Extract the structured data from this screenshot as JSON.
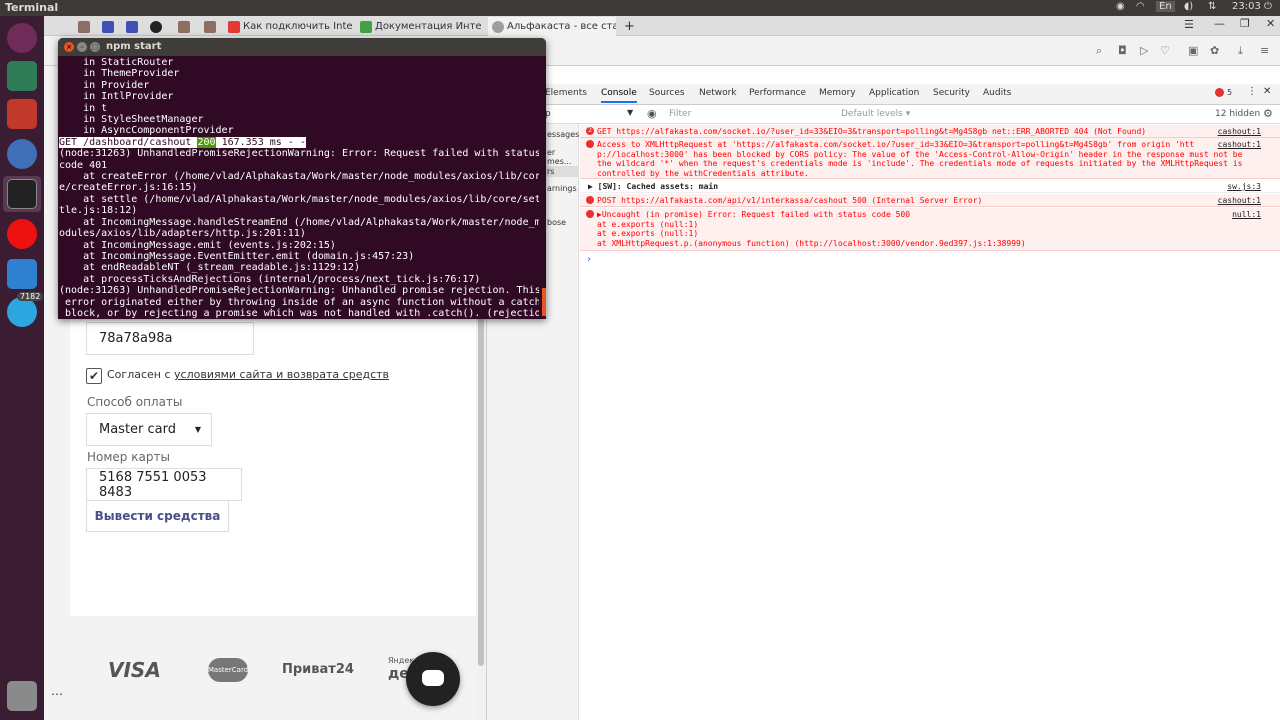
{
  "os": {
    "app_title": "Terminal",
    "lang": "En",
    "clock": "23:03",
    "telegram_badge": "7182",
    "terminal_title": "npm start"
  },
  "browser": {
    "tabs": [
      {
        "label": "",
        "color": "#8d6e63"
      },
      {
        "label": "",
        "color": "#3f51b5"
      },
      {
        "label": "",
        "color": "#3f51b5"
      },
      {
        "label": "",
        "color": "#222222"
      },
      {
        "label": "",
        "color": "#8d6e63"
      },
      {
        "label": "",
        "color": "#8d6e63"
      },
      {
        "label": "Как подключить Inte",
        "color": "#e53935"
      },
      {
        "label": "Документация Инте",
        "color": "#43a047"
      },
      {
        "label": "Альфакаста - все ста",
        "color": "#9e9e9e"
      }
    ]
  },
  "devtools": {
    "tabs": [
      "Elements",
      "Console",
      "Sources",
      "Network",
      "Performance",
      "Memory",
      "Application",
      "Security",
      "Audits"
    ],
    "active_tab": "Console",
    "error_count": "5",
    "context": "p",
    "filter_placeholder": "Filter",
    "levels": "Default levels ▾",
    "hidden": "12 hidden",
    "sidebar": [
      "essages",
      "er mes...",
      "rs",
      "arnings",
      "bose"
    ],
    "console": [
      {
        "type": "error",
        "badge": "2",
        "text": "GET https://alfakasta.com/socket.io/?user_id=33&EIO=3&transport=polling&t=Mg4S8gb net::ERR_ABORTED 404 (Not Found)",
        "source": "cashout:1"
      },
      {
        "type": "error",
        "lines": [
          "Access to XMLHttpRequest at 'https://alfakasta.com/socket.io/?user_id=33&EIO=3&transport=polling&t=Mg4S8gb' from origin 'htt",
          "p://localhost:3000' has been blocked by CORS policy: The value of the 'Access-Control-Allow-Origin' header in the response must not be",
          "the wildcard '*' when the request's credentials mode is 'include'. The credentials mode of requests initiated by the XMLHttpRequest is",
          "controlled by the withCredentials attribute."
        ],
        "source": "cashout:1"
      },
      {
        "type": "info",
        "text": "▶ [SW]: Cached assets: main",
        "source": "sw.js:3"
      },
      {
        "type": "error",
        "text": "POST https://alfakasta.com/api/v1/interkassa/cashout 500 (Internal Server Error)",
        "source": "cashout:1"
      },
      {
        "type": "error",
        "lines": [
          "▶Uncaught (in promise) Error: Request failed with status code 500",
          "    at e.exports (null:1)",
          "    at e.exports (null:1)",
          "    at XMLHttpRequest.p.(anonymous function) (http://localhost:3000/vendor.9ed397.js:1:38999)"
        ],
        "source": "null:1"
      }
    ],
    "prompt": "›"
  },
  "terminal": {
    "lines_before": [
      "    in StaticRouter",
      "    in ThemeProvider",
      "    in Provider",
      "    in IntlProvider",
      "    in t",
      "    in StyleSheetManager",
      "    in AsyncComponentProvider"
    ],
    "request": {
      "method_path": "GET /dashboard/cashout ",
      "status": "200",
      "rest": " 167.353 ms - -"
    },
    "lines_after": [
      "(node:31263) UnhandledPromiseRejectionWarning: Error: Request failed with status",
      "code 401",
      "    at createError (/home/vlad/Alphakasta/Work/master/node_modules/axios/lib/cor",
      "e/createError.js:16:15)",
      "    at settle (/home/vlad/Alphakasta/Work/master/node_modules/axios/lib/core/set",
      "tle.js:18:12)",
      "    at IncomingMessage.handleStreamEnd (/home/vlad/Alphakasta/Work/master/node_m",
      "odules/axios/lib/adapters/http.js:201:11)",
      "    at IncomingMessage.emit (events.js:202:15)",
      "    at IncomingMessage.EventEmitter.emit (domain.js:457:23)",
      "    at endReadableNT (_stream_readable.js:1129:12)",
      "    at processTicksAndRejections (internal/process/next_tick.js:76:17)",
      "(node:31263) UnhandledPromiseRejectionWarning: Unhandled promise rejection. This",
      " error originated either by throwing inside of an async function without a catch",
      " block, or by rejecting a promise which was not handled with .catch(). (rejectio"
    ]
  },
  "form": {
    "wallet_value": "78a78a98a",
    "agree_prefix": "Согласен с ",
    "agree_link": "условиями сайта и возврата средств",
    "payment_label": "Способ оплаты",
    "payment_value": "Master card",
    "card_label": "Номер карты",
    "card_value": "5168 7551 0053 8483",
    "submit": "Вывести средства"
  },
  "footer_logos": [
    "VISA",
    "MasterCard",
    "Приват24",
    "Яндекс",
    "день"
  ]
}
